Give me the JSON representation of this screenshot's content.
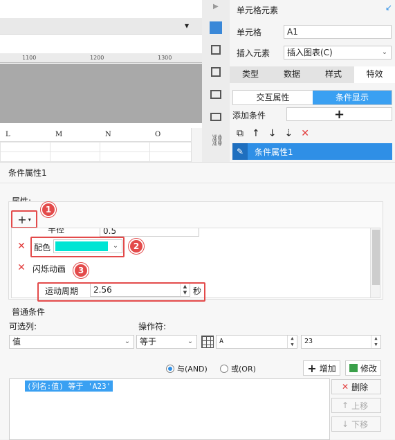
{
  "sheet": {
    "ruler_labels": [
      "1100",
      "1200",
      "1300"
    ],
    "col_headers": [
      "L",
      "M",
      "N",
      "O"
    ]
  },
  "right_panel": {
    "title": "单元格元素",
    "cell_label": "单元格",
    "cell_value": "A1",
    "insert_label": "插入元素",
    "insert_value": "插入图表(C)",
    "tabs": [
      "类型",
      "数据",
      "样式",
      "特效"
    ],
    "subtabs": [
      "交互属性",
      "条件显示"
    ],
    "add_condition_label": "添加条件",
    "condition_item": "条件属性1"
  },
  "dialog": {
    "title": "条件属性1",
    "attributes_label": "属性:",
    "row_partial_label": "半径",
    "row_partial_value": "0.5",
    "color_label": "配色",
    "color_value": "#00e5d4",
    "flash_label": "闪烁动画",
    "period_label": "运动周期",
    "period_value": "2.56",
    "period_unit": "秒",
    "normal_cond_label": "普通条件",
    "optional_col_label": "可选列:",
    "optional_col_value": "值",
    "operator_label": "操作符:",
    "operator_value": "等于",
    "op_field_1": "A",
    "op_field_2": "23",
    "radio_and": "与(AND)",
    "radio_or": "或(OR)",
    "add_button": "增加",
    "modify_button": "修改",
    "condition_text": "(列名:值) 等于 'A23'",
    "delete_button": "删除",
    "up_button": "上移",
    "down_button": "下移"
  },
  "badges": [
    "1",
    "2",
    "3"
  ],
  "colors": {
    "accent": "#3aa0f2",
    "selected": "#2f8fe6",
    "annotation": "#e34a4a"
  }
}
